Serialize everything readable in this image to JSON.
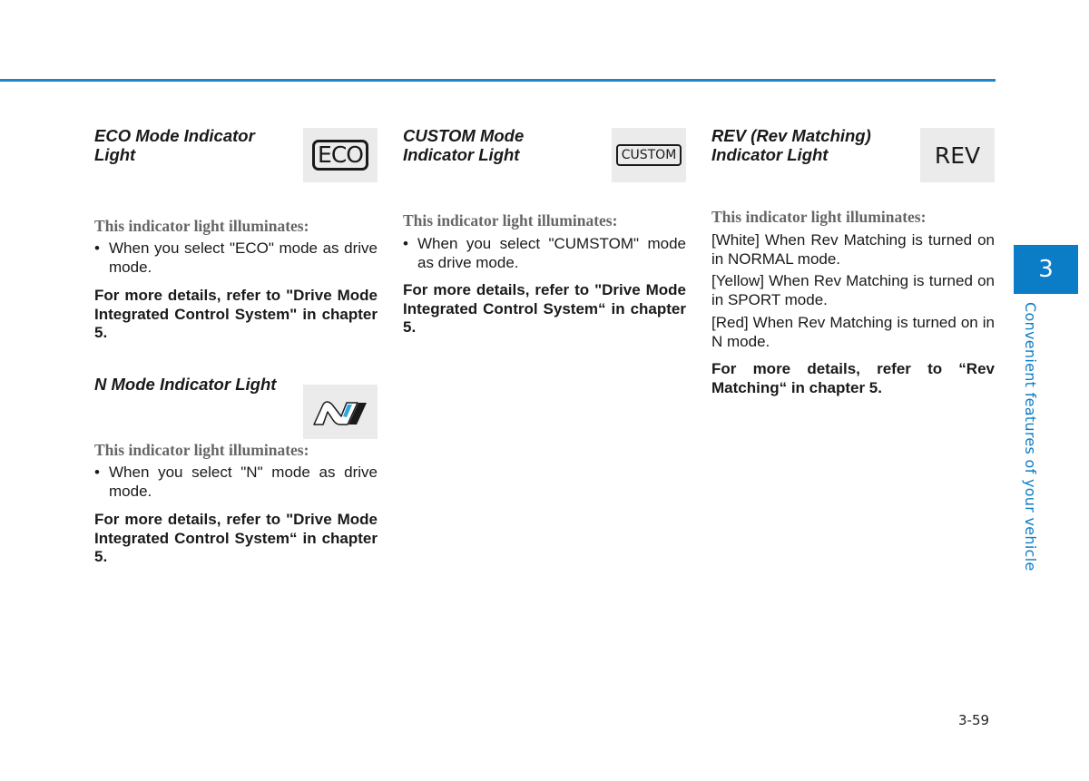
{
  "sections": {
    "eco": {
      "heading_line1": "ECO Mode Indicator",
      "heading_line2": "Light",
      "icon_label": "ECO",
      "illuminates": "This indicator light illuminates:",
      "bullet": "When you select \"ECO\" mode as drive mode.",
      "details": "For more details, refer to \"Drive Mode Integrated Control System\" in chapter 5."
    },
    "n_mode": {
      "heading": "N Mode Indicator Light",
      "illuminates": "This indicator light illuminates:",
      "bullet": "When you select \"N\" mode as drive mode.",
      "details": "For more details, refer to \"Drive Mode Integrated Control System“ in chapter 5."
    },
    "custom": {
      "heading_line1": "CUSTOM Mode",
      "heading_line2": "Indicator Light",
      "icon_label": "CUSTOM",
      "illuminates": "This indicator light illuminates:",
      "bullet": "When you select \"CUMSTOM\" mode as drive mode.",
      "details": "For more details, refer to \"Drive Mode Integrated Control System“ in chapter 5."
    },
    "rev": {
      "heading_line1": "REV (Rev Matching)",
      "heading_line2": "Indicator Light",
      "icon_label": "REV",
      "illuminates": "This indicator light illuminates:",
      "items": [
        "[White] When Rev Matching is turned on in NORMAL mode.",
        "[Yellow] When Rev Matching is turned on in SPORT mode.",
        "[Red] When Rev Matching is turned on in N mode."
      ],
      "details": "For more details, refer to “Rev Matching“ in chapter 5."
    }
  },
  "side_tab": {
    "chapter_number": "3",
    "chapter_title": "Convenient features of your vehicle"
  },
  "page_number": "3-59",
  "colors": {
    "accent": "#0b7dc6",
    "icon_background": "#ebebeb",
    "n_logo_blue": "#2fa6dc"
  }
}
